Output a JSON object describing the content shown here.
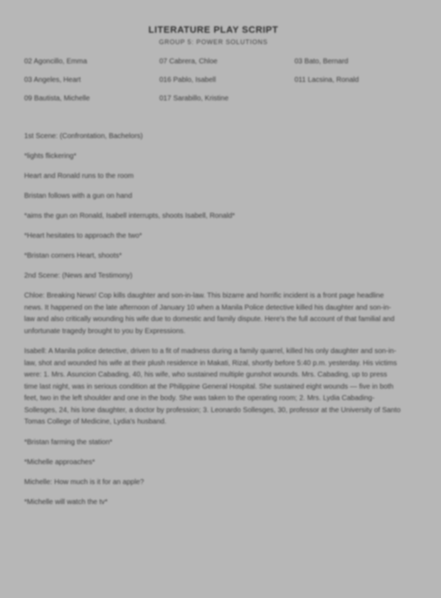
{
  "document": {
    "title": "LITERATURE PLAY SCRIPT",
    "subtitle": "GROUP 5: POWER SOLUTIONS",
    "members": {
      "col1": [
        "02 Agoncillo, Emma",
        "03 Angeles, Heart",
        "09 Bautista, Michelle"
      ],
      "col2": [
        "07 Cabrera, Chloe",
        "016 Pablo, Isabell",
        "017 Sarabillo, Kristine"
      ],
      "col3": [
        "03 Bato, Bernard",
        "011 Lacsina, Ronald"
      ]
    },
    "script": {
      "line1": "1st Scene: (Confrontation, Bachelors)",
      "line2": "*lights flickering*",
      "line3": "Heart and Ronald runs to the room",
      "line4": "Bristan follows with a gun on hand",
      "line5": "*aims the gun on Ronald, Isabell interrupts, shoots Isabell, Ronald*",
      "line6": "*Heart hesitates to approach the two*",
      "line7": "*Bristan corners Heart, shoots*",
      "line8": "2nd Scene: (News and Testimony)",
      "para1": "Chloe: Breaking News! Cop kills daughter and son-in-law. This bizarre and horrific incident is a front page headline news. It happened on the late afternoon of January 10 when a Manila Police detective killed his daughter and son-in-law and also critically wounding his wife due to domestic and family dispute. Here's the full account of that familial and unfortunate tragedy brought to you by Expressions.",
      "para2": "Isabell: A Manila police detective, driven to a fit of madness during a family quarrel, killed his only daughter and son-in-law, shot and wounded his wife at their plush residence in Makati, Rizal, shortly before 5:40 p.m. yesterday. His victims were: 1. Mrs. Asuncion Cabading, 40, his wife, who sustained multiple gunshot wounds. Mrs. Cabading, up to press time last night, was in serious condition at the Philippine General Hospital. She sustained eight wounds — five in both feet, two in the left shoulder and one in the body. She was taken to the operating room; 2. Mrs. Lydia Cabading-Sollesges, 24, his lone daughter, a doctor by profession; 3. Leonardo Sollesges, 30, professor at the University of Santo Tomas College of Medicine, Lydia's husband.",
      "line9": "*Bristan farming the station*",
      "line10": "*Michelle approaches*",
      "line11": "Michelle: How much is it for an apple?",
      "line12": "*Michelle will watch the tv*"
    }
  }
}
